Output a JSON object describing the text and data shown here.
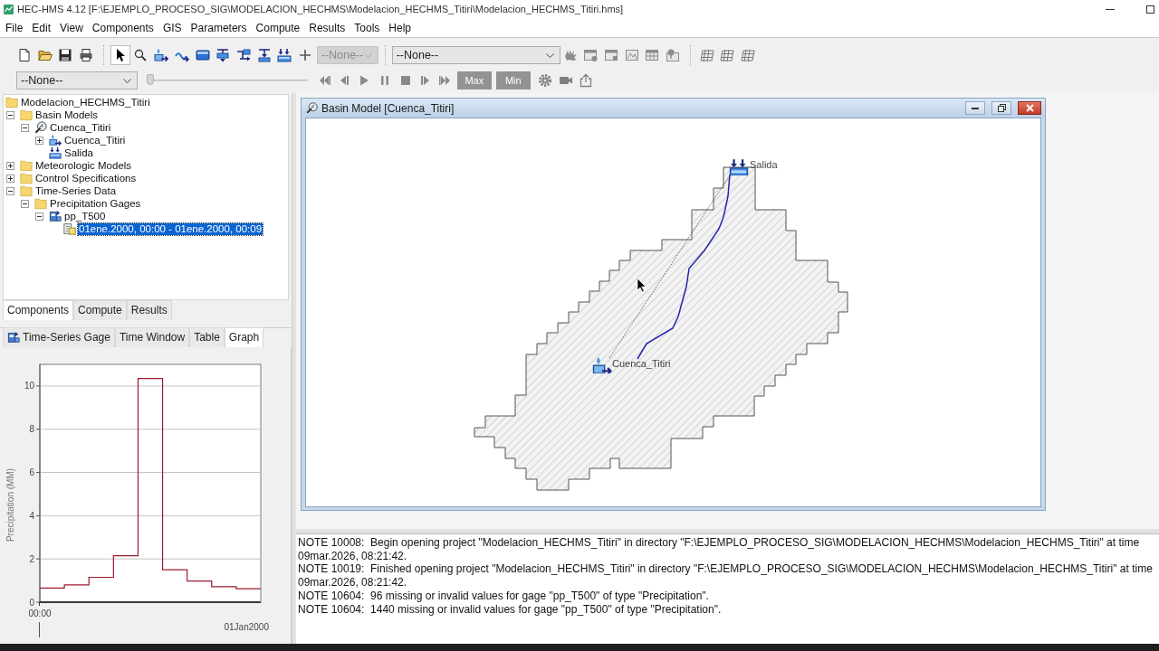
{
  "window": {
    "title": "HEC-HMS 4.12 [F:\\EJEMPLO_PROCESO_SIG\\MODELACION_HECHMS\\Modelacion_HECHMS_Titiri\\Modelacion_HECHMS_Titiri.hms]"
  },
  "menu": [
    "File",
    "Edit",
    "View",
    "Components",
    "GIS",
    "Parameters",
    "Compute",
    "Results",
    "Tools",
    "Help"
  ],
  "toolbar": {
    "tools": [
      {
        "selected": true
      },
      {
        "selected": false
      },
      {
        "selected": false
      },
      {
        "selected": false
      },
      {
        "selected": false
      },
      {
        "selected": false
      },
      {
        "selected": false
      },
      {
        "selected": false
      },
      {
        "selected": false
      },
      {
        "selected": false
      }
    ],
    "element_combo": {
      "value": "--None--",
      "disabled": true
    },
    "map_combo": {
      "value": "--None--",
      "disabled": false
    },
    "map_tools": [
      {
        "disabled": true
      },
      {
        "disabled": true
      },
      {
        "disabled": true
      },
      {
        "disabled": true
      },
      {
        "disabled": true
      },
      {
        "disabled": true
      }
    ]
  },
  "player": {
    "time_combo": {
      "value": "--None--",
      "disabled": false
    },
    "slider": {
      "level": 0
    },
    "controls": [
      {
        "disabled": true
      },
      {
        "disabled": true
      },
      {
        "disabled": true
      },
      {
        "disabled": true
      },
      {
        "disabled": true
      },
      {
        "disabled": true
      },
      {
        "disabled": true
      }
    ],
    "max_button": {
      "label": "Max",
      "disabled": true
    },
    "min_button": {
      "label": "Min",
      "disabled": true
    }
  },
  "tree": [
    {
      "label": "Modelacion_HECHMS_Titiri",
      "kind": "folder",
      "selected": false,
      "children": [
        {
          "label": "Basin Models",
          "kind": "folder",
          "expanded": true,
          "selected": false,
          "children": [
            {
              "label": "Cuenca_Titiri",
              "kind": "basin",
              "expanded": true,
              "selected": false,
              "children": [
                {
                  "label": "Cuenca_Titiri",
                  "kind": "subbasin",
                  "expanded": false,
                  "selected": false
                },
                {
                  "label": "Salida",
                  "kind": "sink",
                  "selected": false
                }
              ]
            }
          ]
        },
        {
          "label": "Meteorologic Models",
          "kind": "folder",
          "expanded": false,
          "selected": false
        },
        {
          "label": "Control Specifications",
          "kind": "folder",
          "expanded": false,
          "selected": false
        },
        {
          "label": "Time-Series Data",
          "kind": "folder",
          "expanded": true,
          "selected": false,
          "children": [
            {
              "label": "Precipitation Gages",
              "kind": "folder",
              "expanded": true,
              "selected": false,
              "children": [
                {
                  "label": "pp_T500",
                  "kind": "gage",
                  "expanded": true,
                  "selected": false,
                  "children": [
                    {
                      "label": "01ene.2000, 00:00 - 01ene.2000, 00:09",
                      "kind": "series",
                      "selected": true
                    }
                  ]
                }
              ]
            }
          ]
        }
      ]
    }
  ],
  "explorer_tabs": [
    {
      "label": "Components",
      "selected": true
    },
    {
      "label": "Compute",
      "selected": false
    },
    {
      "label": "Results",
      "selected": false
    }
  ],
  "editor_tabs": [
    {
      "label": "Time-Series Gage",
      "selected": false
    },
    {
      "label": "Time Window",
      "selected": false
    },
    {
      "label": "Table",
      "selected": false
    },
    {
      "label": "Graph",
      "selected": true
    }
  ],
  "graph": {
    "y_axis_title": "Precipitation (MM)",
    "y_tick_labels": [
      "10",
      "8",
      "6",
      "4",
      "2",
      "0"
    ],
    "x_tick_label": "00:00",
    "date_label": "01Jan2000"
  },
  "basin_window": {
    "title": "Basin Model [Cuenca_Titiri]",
    "elements": [
      {
        "kind": "sink",
        "label": "Salida"
      },
      {
        "kind": "subbasin",
        "label": "Cuenca_Titiri"
      }
    ]
  },
  "log": [
    "NOTE 10008:  Begin opening project \"Modelacion_HECHMS_Titiri\" in directory \"F:\\EJEMPLO_PROCESO_SIG\\MODELACION_HECHMS\\Modelacion_HECHMS_Titiri\" at time 09mar.2026, 08:21:42.",
    "NOTE 10019:  Finished opening project \"Modelacion_HECHMS_Titiri\" in directory \"F:\\EJEMPLO_PROCESO_SIG\\MODELACION_HECHMS\\Modelacion_HECHMS_Titiri\" at time 09mar.2026, 08:21:42.",
    "NOTE 10604:  96 missing or invalid values for gage \"pp_T500\" of type \"Precipitation\".",
    "NOTE 10604:  1440 missing or invalid values for gage \"pp_T500\" of type \"Precipitation\"."
  ]
}
